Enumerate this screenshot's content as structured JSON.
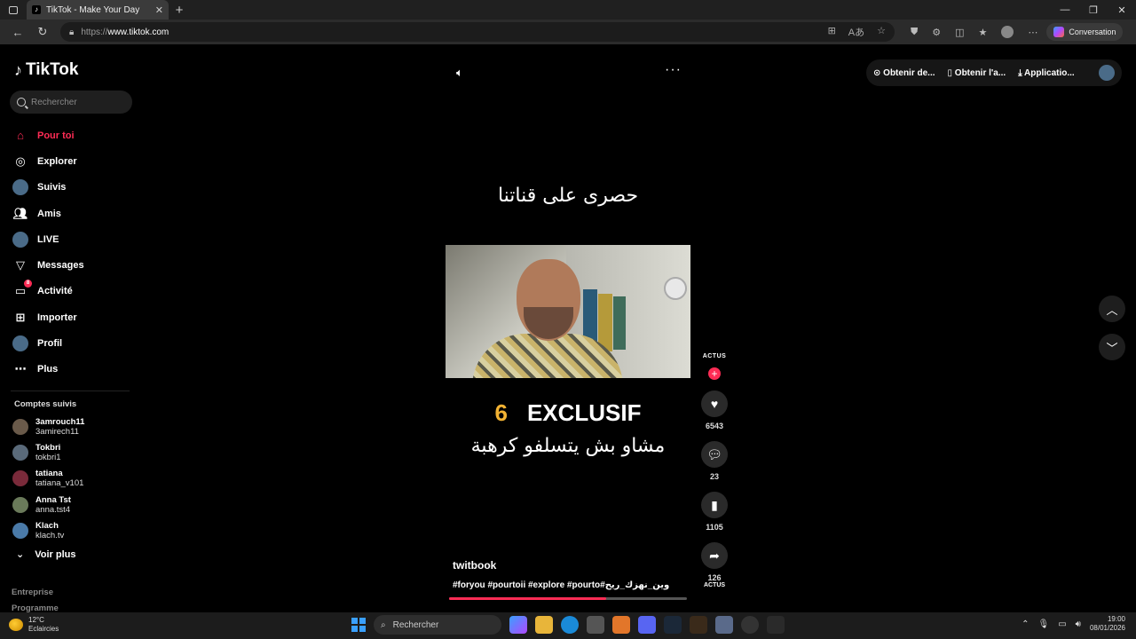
{
  "browser": {
    "tab_title": "TikTok - Make Your Day",
    "tab_close": "✕",
    "new_tab": "+",
    "url_protocol": "https://",
    "url_host": "www.tiktok.com",
    "conversation_label": "Conversation"
  },
  "sidebar": {
    "logo": "TikTok",
    "search_placeholder": "Rechercher",
    "nav": [
      {
        "label": "Pour toi",
        "icon": "home-icon"
      },
      {
        "label": "Explorer",
        "icon": "compass-icon"
      },
      {
        "label": "Suivis",
        "icon": "following-avatar-icon"
      },
      {
        "label": "Amis",
        "icon": "friends-icon"
      },
      {
        "label": "LIVE",
        "icon": "live-icon"
      },
      {
        "label": "Messages",
        "icon": "send-icon"
      },
      {
        "label": "Activité",
        "icon": "inbox-icon",
        "badge": "8"
      },
      {
        "label": "Importer",
        "icon": "upload-icon"
      },
      {
        "label": "Profil",
        "icon": "profile-avatar-icon"
      },
      {
        "label": "Plus",
        "icon": "more-icon"
      }
    ],
    "followed_title": "Comptes suivis",
    "followed": [
      {
        "name": "3amrouch11",
        "handle": "3amirech11"
      },
      {
        "name": "Tokbri",
        "handle": "tokbri1"
      },
      {
        "name": "tatiana",
        "handle": "tatiana_v101"
      },
      {
        "name": "Anna Tst",
        "handle": "anna.tst4"
      },
      {
        "name": "Klach",
        "handle": "klach.tv"
      }
    ],
    "see_more": "Voir plus",
    "footer_company": "Entreprise",
    "footer_program": "Programme"
  },
  "header": {
    "get_coins": "Obtenir de...",
    "get_app": "Obtenir l'a...",
    "application": "Applicatio..."
  },
  "video": {
    "arabic_top": "حصرى على قناتنا",
    "badge_number": "6",
    "exclusive": "EXCLUSIF",
    "arabic_mid": "مشاو بش يتسلفو كرهبة",
    "author": "twitbook",
    "hashtags": "#foryou #pourtoii #explore #pourto#وين_نهزك_ريح",
    "progress": 0.66
  },
  "actions": {
    "channel_tag": "ACTUS",
    "likes": "6543",
    "comments": "23",
    "saves": "1105",
    "shares": "126"
  },
  "taskbar": {
    "temperature": "12°C",
    "weather_text": "Eclaircies",
    "search_label": "Rechercher",
    "time": "19:00",
    "date": "08/01/2026"
  }
}
